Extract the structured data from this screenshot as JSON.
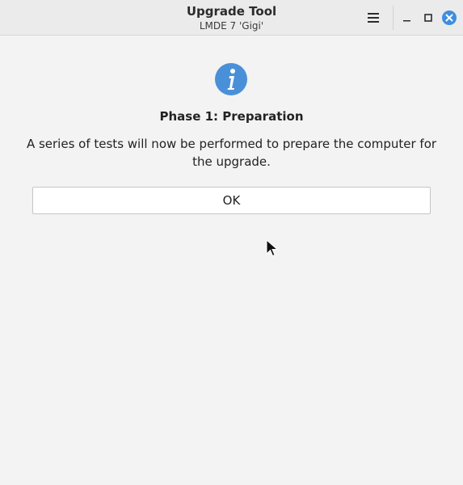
{
  "window": {
    "title": "Upgrade Tool",
    "subtitle": "LMDE 7 'Gigi'",
    "controls": [
      "menu-icon",
      "minimize-icon",
      "maximize-icon",
      "close-icon"
    ]
  },
  "dialog": {
    "icon": "info-icon",
    "heading": "Phase 1: Preparation",
    "message": "A series of tests will now be performed to prepare the computer for the upgrade.",
    "ok_label": "OK"
  },
  "colors": {
    "info_blue": "#4a90d9",
    "close_blue": "#3d8ee0",
    "background": "#f3f3f3"
  }
}
